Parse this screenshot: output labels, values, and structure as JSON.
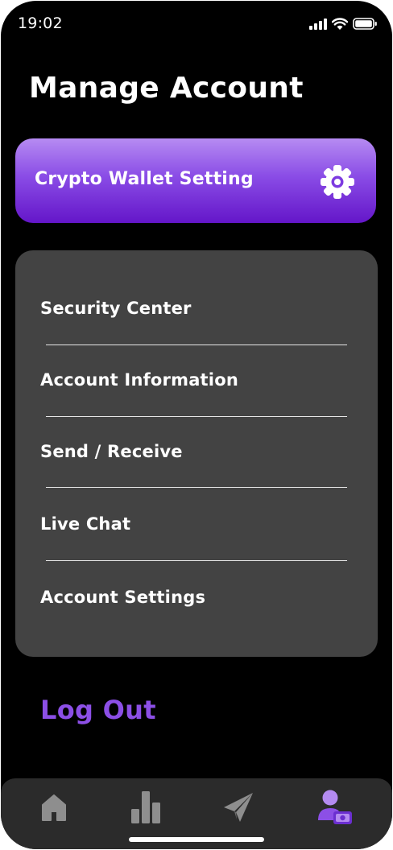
{
  "status": {
    "time": "19:02"
  },
  "page": {
    "title": "Manage Account"
  },
  "wallet_card": {
    "label": "Crypto Wallet Setting"
  },
  "menu": {
    "items": [
      {
        "label": "Security Center"
      },
      {
        "label": "Account Information"
      },
      {
        "label": "Send / Receive"
      },
      {
        "label": "Live Chat"
      },
      {
        "label": "Account Settings"
      }
    ]
  },
  "logout": {
    "label": "Log Out"
  },
  "tab_bar": {
    "tabs": [
      {
        "icon": "home-icon",
        "active": false
      },
      {
        "icon": "bar-chart-icon",
        "active": false
      },
      {
        "icon": "send-icon",
        "active": false
      },
      {
        "icon": "account-wallet-icon",
        "active": true
      }
    ]
  },
  "colors": {
    "background": "#000000",
    "accent": "#8c4fe6",
    "card": "#434343",
    "tab_bar": "#2b2b2b",
    "tab_inactive": "#8e8e8e"
  }
}
